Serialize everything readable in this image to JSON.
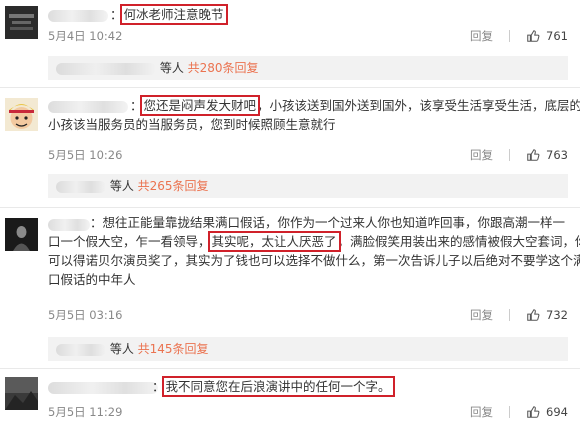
{
  "comments": [
    {
      "text_parts": [
        "：",
        "何冰老师注意晚节"
      ],
      "date": "5月4日 10:42",
      "reply_label": "回复",
      "likes": "761",
      "replies": {
        "prefix": "等人 ",
        "more": "共280条回复"
      }
    },
    {
      "line1_parts": [
        "：",
        "您还是闷声发大财吧",
        "，小孩该送到国外送到国外，该享受生活享受生活，底层的"
      ],
      "line2": "小孩该当服务员的当服务员，您到时候照顾生意就行",
      "date": "5月5日 10:26",
      "reply_label": "回复",
      "likes": "763",
      "replies": {
        "prefix": "等人 ",
        "more": "共265条回复"
      }
    },
    {
      "line1": "：想往正能量靠拢结果满口假话，你作为一个过来人你也知道咋回事，你跟高潮一样一",
      "line2_parts": [
        "口一个假大空，乍一看领导，",
        "其实呢，太让人厌恶了",
        "，满脸假笑用装出来的感情被假大空套词，你"
      ],
      "line3": "可以得诺贝尔演员奖了，其实为了钱也可以选择不做什么，第一次告诉儿子以后绝对不要学这个满",
      "line4": "口假话的中年人",
      "date": "5月5日 03:16",
      "reply_label": "回复",
      "likes": "732",
      "replies": {
        "prefix": "等人 ",
        "more": "共145条回复"
      }
    },
    {
      "text_parts": [
        "：",
        "我不同意您在后浪演讲中的任何一个字。"
      ],
      "date": "5月5日 11:29",
      "reply_label": "回复",
      "likes": "694"
    }
  ],
  "icons": {
    "like": "thumbs-up-icon"
  },
  "colors": {
    "highlight": "#d0212a",
    "link": "#eb7350"
  }
}
